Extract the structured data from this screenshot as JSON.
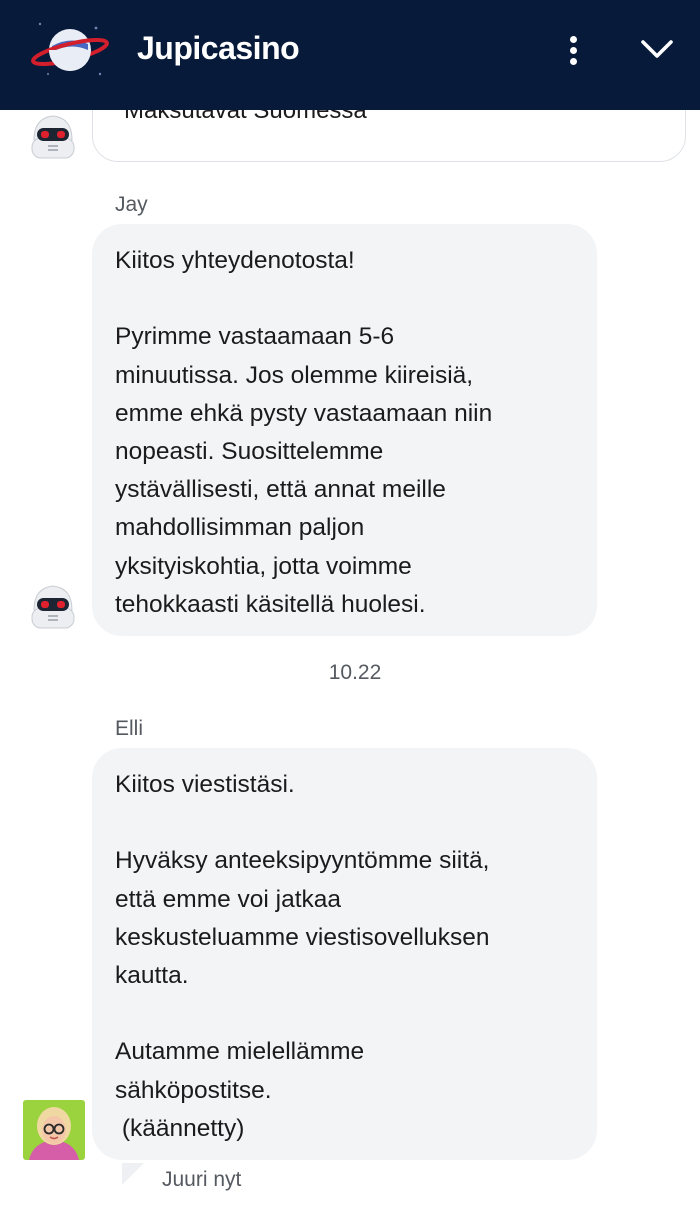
{
  "header": {
    "title": "Jupicasino",
    "logo_icon": "planet-logo-icon",
    "menu_icon": "more-vertical-icon",
    "collapse_icon": "chevron-down-icon",
    "background": "#071a3a"
  },
  "messages": {
    "previous": {
      "text": "Maksutavat Suomessa"
    },
    "jay": {
      "sender": "Jay",
      "text": "Kiitos yhteydenotosta!\n\nPyrimme vastaamaan 5-6\nminuutissa. Jos olemme kiireisiä,\nemme ehkä pysty vastaamaan niin\nnopeasti. Suosittelemme\nystävällisesti, että annat meille\nmahdollisimman paljon\nyksityiskohtia, jotta voimme\ntehokkaasti käsitellä huolesi."
    },
    "timestamp": "10.22",
    "elli": {
      "sender": "Elli",
      "text": "Kiitos viestistäsi.\n\nHyväksy anteeksipyyntömme siitä,\nettä emme voi jatkaa\nkeskusteluamme viestisovelluksen\nkautta.\n\nAutamme mielellämme\nsähköpostitse.\n (käännetty)",
      "status": "Juuri nyt"
    }
  }
}
